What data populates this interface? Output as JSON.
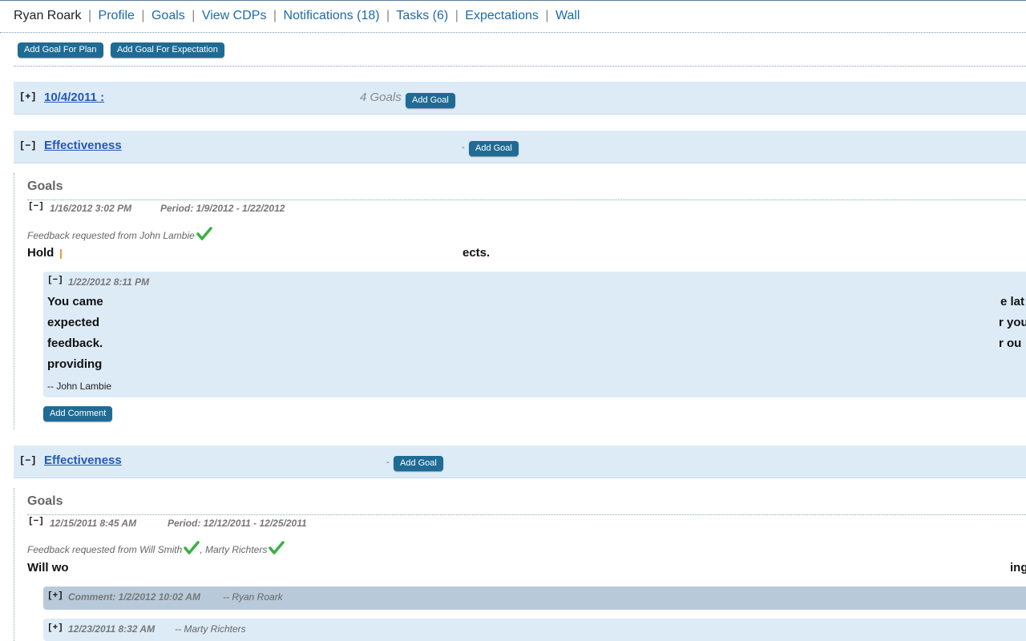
{
  "nav": {
    "user": "Ryan Roark",
    "links": [
      "Profile",
      "Goals",
      "View CDPs",
      "Notifications (18)",
      "Tasks (6)",
      "Expectations",
      "Wall"
    ],
    "sep": "|"
  },
  "actions": {
    "add_goal_plan": "Add Goal For Plan",
    "add_goal_expectation": "Add Goal For Expectation"
  },
  "groups": [
    {
      "toggle": "[+]",
      "title": "10/4/2011 :",
      "count": "4 Goals",
      "add_label": "Add Goal"
    },
    {
      "toggle": "[−]",
      "title": "Effectiveness",
      "dash": "-",
      "add_label": "Add Goal"
    },
    {
      "toggle": "[−]",
      "title": "Effectiveness",
      "dash": "-",
      "add_label": "Add Goal"
    }
  ],
  "section1": {
    "title": "Goals",
    "goal": {
      "toggle": "[−]",
      "date": "1/16/2012 3:02 PM",
      "period": "Period: 1/9/2012 - 1/22/2012",
      "feedback": "Feedback requested from John Lambie",
      "text_start": "Hold",
      "text_end": "ects."
    },
    "comment": {
      "toggle": "[−]",
      "date": "1/22/2012 8:11 PM",
      "lines_left": [
        "You came",
        "expected",
        "feedback.",
        "providing"
      ],
      "lines_right": [
        "e lat",
        "r you",
        "r ou"
      ],
      "author": "-- John Lambie"
    },
    "add_comment": "Add Comment"
  },
  "section2": {
    "title": "Goals",
    "goal": {
      "toggle": "[−]",
      "date": "12/15/2011 8:45 AM",
      "period": "Period: 12/12/2011 - 12/25/2011",
      "feedback_prefix": "Feedback requested from Will Smith",
      "feedback_second": ", Marty Richters",
      "text_start": "Will wo",
      "text_end": "ing"
    },
    "comments": [
      {
        "toggle": "[+]",
        "label": "Comment: 1/2/2012 10:02 AM",
        "author": "-- Ryan Roark"
      },
      {
        "toggle": "[+]",
        "label": "12/23/2011 8:32 AM",
        "author": "-- Marty Richters"
      }
    ]
  },
  "colors": {
    "accent": "#1f6b94",
    "group_bg": "#ddebf7",
    "link": "#2358b8",
    "check": "#3cb043",
    "collapsed_comment_bg": "#b8cad9"
  }
}
